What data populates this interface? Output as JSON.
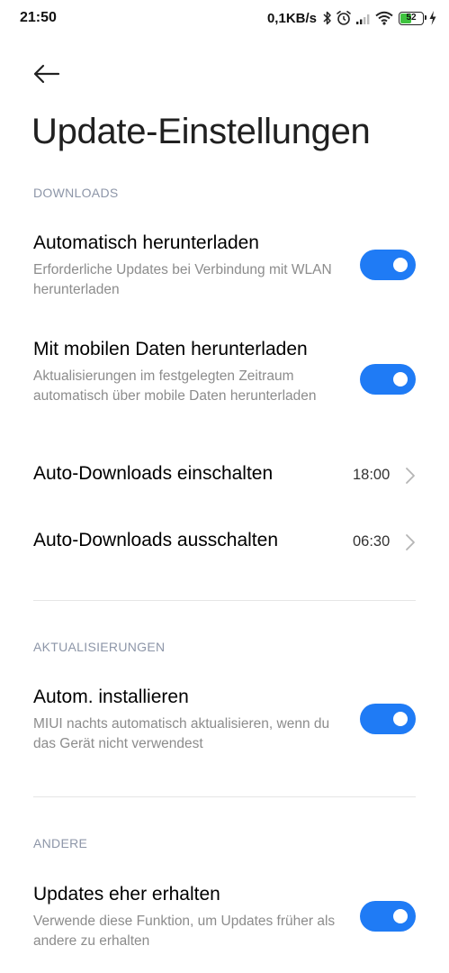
{
  "status_bar": {
    "time": "21:50",
    "net_speed": "0,1KB/s",
    "battery_level": 52,
    "battery_text": "52",
    "icons": [
      "bluetooth-icon",
      "alarm-icon",
      "signal-icon",
      "wifi-icon",
      "battery-icon",
      "charging-icon"
    ]
  },
  "header": {
    "back_icon": "arrow-left-icon",
    "title": "Update-Einstellungen"
  },
  "sections": {
    "downloads": {
      "header": "DOWNLOADS",
      "auto_download": {
        "title": "Automatisch herunterladen",
        "subtitle": "Erforderliche Updates bei Verbindung mit WLAN herunterladen",
        "enabled": true
      },
      "mobile_data": {
        "title": "Mit mobilen Daten herunterladen",
        "subtitle": "Aktualisierungen im festgelegten Zeitraum automatisch über mobile Daten herunterladen",
        "enabled": true
      },
      "auto_on": {
        "title": "Auto-Downloads einschalten",
        "value": "18:00"
      },
      "auto_off": {
        "title": "Auto-Downloads ausschalten",
        "value": "06:30"
      }
    },
    "updates": {
      "header": "AKTUALISIERUNGEN",
      "auto_install": {
        "title": "Autom. installieren",
        "subtitle": "MIUI nachts automatisch aktualisieren, wenn du das Gerät nicht verwendest",
        "enabled": true
      }
    },
    "other": {
      "header": "ANDERE",
      "early_updates": {
        "title": "Updates eher erhalten",
        "subtitle": "Verwende diese Funktion, um Updates früher als andere zu erhalten",
        "enabled": true
      }
    }
  },
  "colors": {
    "accent": "#1f7bf5",
    "section_header": "#8d96a8",
    "subtitle": "#8c8c8c",
    "divider": "#e6e6e6"
  }
}
